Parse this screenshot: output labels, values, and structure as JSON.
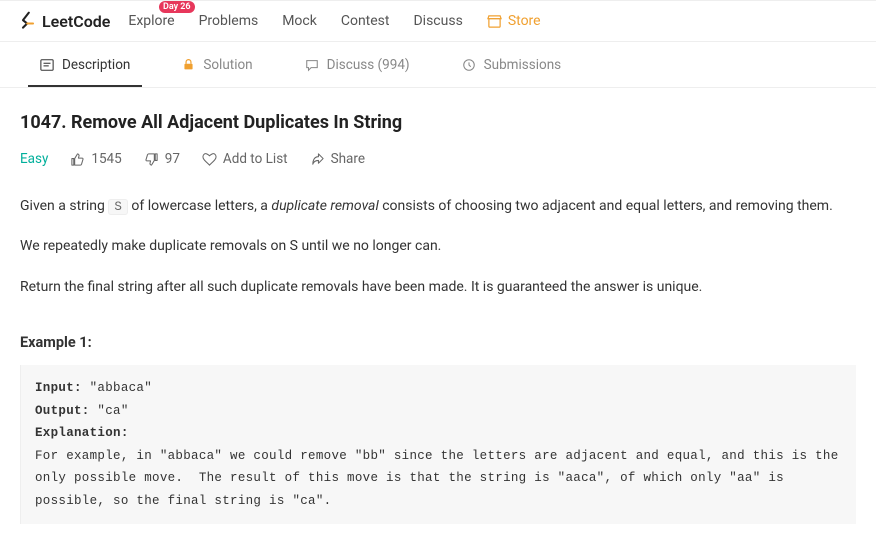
{
  "site": {
    "brand": "LeetCode"
  },
  "nav": {
    "explore": "Explore",
    "problems": "Problems",
    "mock": "Mock",
    "contest": "Contest",
    "discuss": "Discuss",
    "store": "Store",
    "day_badge": "Day 26"
  },
  "tabs": {
    "description": "Description",
    "solution": "Solution",
    "discuss": "Discuss (994)",
    "submissions": "Submissions"
  },
  "problem": {
    "title": "1047. Remove All Adjacent Duplicates In String",
    "difficulty": "Easy",
    "likes": "1545",
    "dislikes": "97",
    "add_to_list": "Add to List",
    "share": "Share",
    "p1_a": "Given a string ",
    "p1_code": "S",
    "p1_b": " of lowercase letters, a ",
    "p1_i": "duplicate removal",
    "p1_c": " consists of choosing two adjacent and equal letters, and removing them.",
    "p2": "We repeatedly make duplicate removals on S until we no longer can.",
    "p3": "Return the final string after all such duplicate removals have been made.  It is guaranteed the answer is unique.",
    "example_label": "Example 1:",
    "example": {
      "input_label": "Input: ",
      "input_val": "\"abbaca\"",
      "output_label": "Output: ",
      "output_val": "\"ca\"",
      "explanation_label": "Explanation: ",
      "explanation_text": "For example, in \"abbaca\" we could remove \"bb\" since the letters are adjacent and equal, and this is the only possible move.  The result of this move is that the string is \"aaca\", of which only \"aa\" is possible, so the final string is \"ca\"."
    }
  }
}
